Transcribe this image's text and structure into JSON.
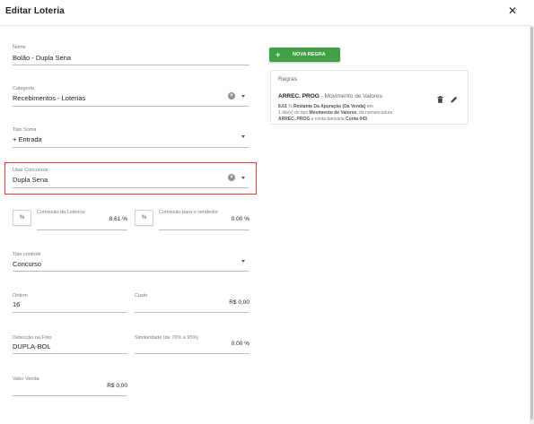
{
  "dialog": {
    "title": "Editar Loteria",
    "close_icon": "close-icon"
  },
  "fields": {
    "nome": {
      "label": "Nome",
      "value": "Bolão - Dupla Sena"
    },
    "categoria": {
      "label": "Categoria",
      "value": "Recebimentos - Loterias"
    },
    "tipo_soma": {
      "label": "Tipo Soma",
      "value": "+ Entrada"
    },
    "usar_concursos": {
      "label": "Usar Concursos",
      "value": "Dupla Sena"
    },
    "comissao_loterica": {
      "button": "%",
      "label": "Comissão da Lotérica",
      "value": "8.61 %"
    },
    "comissao_vendedor": {
      "button": "%",
      "label": "Comissão para o vendedor",
      "value": "0.00 %"
    },
    "tipo_controle": {
      "label": "Tipo controle",
      "value": "Concurso"
    },
    "ordem": {
      "label": "Ordem",
      "value": "16"
    },
    "custo": {
      "label": "Custo",
      "value": "R$ 0,00"
    },
    "deteccao": {
      "label": "Detecção na Foto",
      "value": "DUPLA-BOL"
    },
    "similaridade": {
      "label": "Similaridade (de 70% a 95%)",
      "value": "0.00 %"
    },
    "valor_venda": {
      "label": "Valor Venda",
      "value": "R$ 0,00"
    }
  },
  "rules": {
    "add_button": "NOVA REGRA",
    "title": "Regras",
    "item": {
      "name": "ARREC. PROG",
      "subtitle": " - Movimento de Valores",
      "line1_a": "8.61",
      "line1_b": " % ",
      "line1_c": "Restante",
      "line1_d": "Da Apuração (Da Venda)",
      "line1_e": " em",
      "line2_a": "1 dia(s) do tipo ",
      "line2_b": "Movimento de Valores",
      "line2_c": ", da nomenclatura",
      "line3_a": "ARREC. PROG",
      "line3_b": " e conta bancária ",
      "line3_c": "Conta 043",
      "line3_d": "."
    }
  },
  "colors": {
    "accent_green": "#43a047",
    "highlight_red": "#e53935"
  }
}
